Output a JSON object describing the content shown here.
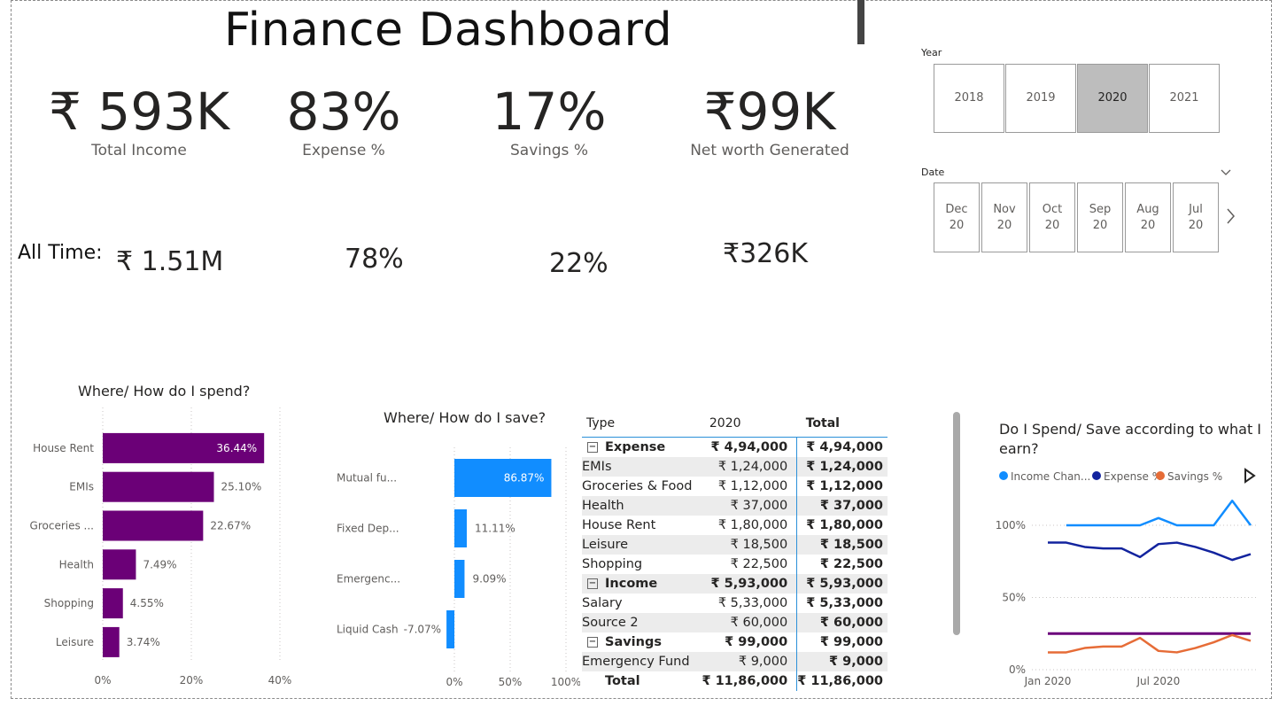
{
  "title": "Finance Dashboard",
  "kpis": [
    {
      "value": "₹ 593K",
      "label": "Total Income"
    },
    {
      "value": "83%",
      "label": "Expense %"
    },
    {
      "value": "17%",
      "label": "Savings %"
    },
    {
      "value": "₹99K",
      "label": "Net worth Generated"
    }
  ],
  "all_time": {
    "label": "All Time:",
    "values": [
      "₹ 1.51M",
      "78%",
      "22%",
      "₹326K"
    ]
  },
  "year_slicer": {
    "title": "Year",
    "options": [
      "2018",
      "2019",
      "2020",
      "2021"
    ],
    "selected": "2020"
  },
  "date_slicer": {
    "title": "Date",
    "options": [
      {
        "month": "Dec",
        "year": "20"
      },
      {
        "month": "Nov",
        "year": "20"
      },
      {
        "month": "Oct",
        "year": "20"
      },
      {
        "month": "Sep",
        "year": "20"
      },
      {
        "month": "Aug",
        "year": "20"
      },
      {
        "month": "Jul",
        "year": "20"
      }
    ],
    "collapse_icon": "chevron-down-icon",
    "next_icon": "chevron-right-icon"
  },
  "spend_chart": {
    "title": "Where/ How do I spend?",
    "color": "#6b0077",
    "chart_data": {
      "type": "bar",
      "orientation": "horizontal",
      "categories": [
        "House Rent",
        "EMIs",
        "Groceries ...",
        "Health",
        "Shopping",
        "Leisure"
      ],
      "values": [
        36.44,
        25.1,
        22.67,
        7.49,
        4.55,
        3.74
      ],
      "data_labels": [
        "36.44%",
        "25.10%",
        "22.67%",
        "7.49%",
        "4.55%",
        "3.74%"
      ],
      "xticks": [
        "0%",
        "20%",
        "40%"
      ],
      "xlim": [
        0,
        40
      ]
    }
  },
  "save_chart": {
    "title": "Where/ How do I save?",
    "color": "#118dff",
    "chart_data": {
      "type": "bar",
      "orientation": "horizontal",
      "categories": [
        "Mutual fu...",
        "Fixed Dep...",
        "Emergenc...",
        "Liquid Cash"
      ],
      "values": [
        86.87,
        11.11,
        9.09,
        -7.07
      ],
      "data_labels": [
        "86.87%",
        "11.11%",
        "9.09%",
        "-7.07%"
      ],
      "xticks": [
        "0%",
        "50%",
        "100%"
      ],
      "xlim": [
        -15,
        100
      ]
    }
  },
  "matrix": {
    "headers": [
      "Type",
      "2020",
      "Total"
    ],
    "rows": [
      {
        "kind": "grp",
        "expander": "⊟",
        "label": "Expense",
        "v2020": "₹ 4,94,000",
        "total": "₹ 4,94,000"
      },
      {
        "kind": "item",
        "label": "EMIs",
        "v2020": "₹ 1,24,000",
        "total": "₹ 1,24,000"
      },
      {
        "kind": "item",
        "label": "Groceries & Food",
        "v2020": "₹ 1,12,000",
        "total": "₹ 1,12,000"
      },
      {
        "kind": "item",
        "label": "Health",
        "v2020": "₹ 37,000",
        "total": "₹ 37,000"
      },
      {
        "kind": "item",
        "label": "House Rent",
        "v2020": "₹ 1,80,000",
        "total": "₹ 1,80,000"
      },
      {
        "kind": "item",
        "label": "Leisure",
        "v2020": "₹ 18,500",
        "total": "₹ 18,500"
      },
      {
        "kind": "item",
        "label": "Shopping",
        "v2020": "₹ 22,500",
        "total": "₹ 22,500"
      },
      {
        "kind": "grp",
        "expander": "⊟",
        "label": "Income",
        "v2020": "₹ 5,93,000",
        "total": "₹ 5,93,000"
      },
      {
        "kind": "item",
        "label": "Salary",
        "v2020": "₹ 5,33,000",
        "total": "₹ 5,33,000"
      },
      {
        "kind": "item",
        "label": "Source 2",
        "v2020": "₹ 60,000",
        "total": "₹ 60,000"
      },
      {
        "kind": "grp",
        "expander": "⊟",
        "label": "Savings",
        "v2020": "₹ 99,000",
        "total": "₹ 99,000"
      },
      {
        "kind": "item",
        "label": "Emergency Fund",
        "v2020": "₹ 9,000",
        "total": "₹ 9,000"
      },
      {
        "kind": "tot",
        "label": "Total",
        "v2020": "₹ 11,86,000",
        "total": "₹ 11,86,000"
      }
    ]
  },
  "line_chart": {
    "title": "Do I Spend/ Save according to what I earn?",
    "legend_more_icon": "play-right-icon",
    "chart_data": {
      "type": "line",
      "x": [
        "Jan 2020",
        "Feb 2020",
        "Mar 2020",
        "Apr 2020",
        "May 2020",
        "Jun 2020",
        "Jul 2020",
        "Aug 2020",
        "Sep 2020",
        "Oct 2020",
        "Nov 2020",
        "Dec 2020"
      ],
      "xticks": [
        "Jan 2020",
        "Jul 2020"
      ],
      "yticks": [
        "100%",
        "50%",
        "0%"
      ],
      "ylim": [
        0,
        120
      ],
      "legend_position": "top-left",
      "series": [
        {
          "name": "Income Chan...",
          "color": "#118dff",
          "values": [
            null,
            100,
            100,
            100,
            100,
            100,
            105,
            100,
            100,
            100,
            117,
            100
          ]
        },
        {
          "name": "Expense %",
          "color": "#12239e",
          "values": [
            88,
            88,
            85,
            84,
            84,
            78,
            87,
            88,
            85,
            81,
            76,
            80
          ]
        },
        {
          "name": "Savings %",
          "color": "#e66c37",
          "values": [
            12,
            12,
            15,
            16,
            16,
            22,
            13,
            12,
            15,
            19,
            24,
            20
          ]
        },
        {
          "name": "",
          "color": "#6b007b",
          "values": [
            25,
            25,
            25,
            25,
            25,
            25,
            25,
            25,
            25,
            25,
            25,
            25
          ]
        }
      ]
    }
  }
}
